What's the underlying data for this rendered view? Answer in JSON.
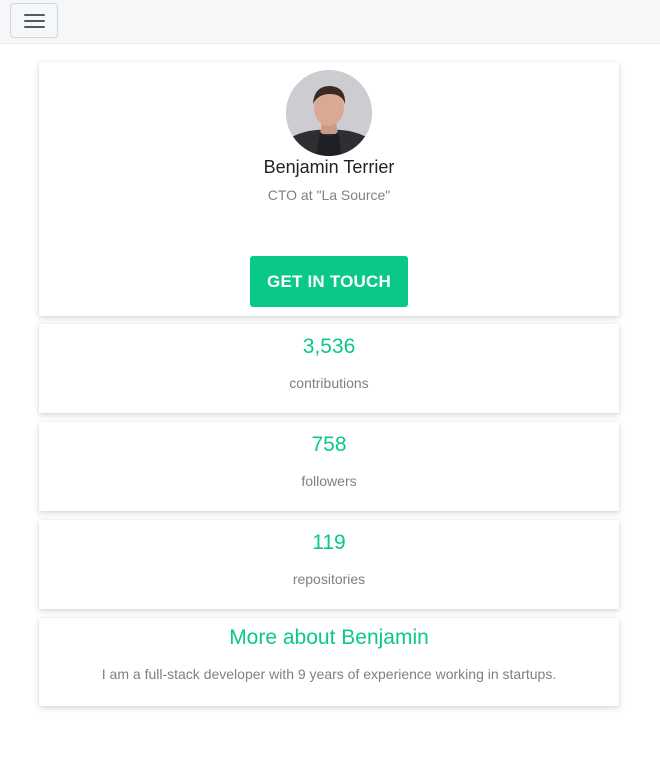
{
  "navbar": {
    "menu_icon": "hamburger-menu-icon"
  },
  "profile": {
    "name": "Benjamin Terrier",
    "title": "CTO at \"La Source\"",
    "cta_label": "GET IN TOUCH",
    "accent_color": "#0ac986"
  },
  "stats": [
    {
      "value": "3,536",
      "label": "contributions"
    },
    {
      "value": "758",
      "label": "followers"
    },
    {
      "value": "119",
      "label": "repositories"
    }
  ],
  "about": {
    "title": "More about Benjamin",
    "text": "I am a full-stack developer with 9 years of experience working in startups."
  }
}
